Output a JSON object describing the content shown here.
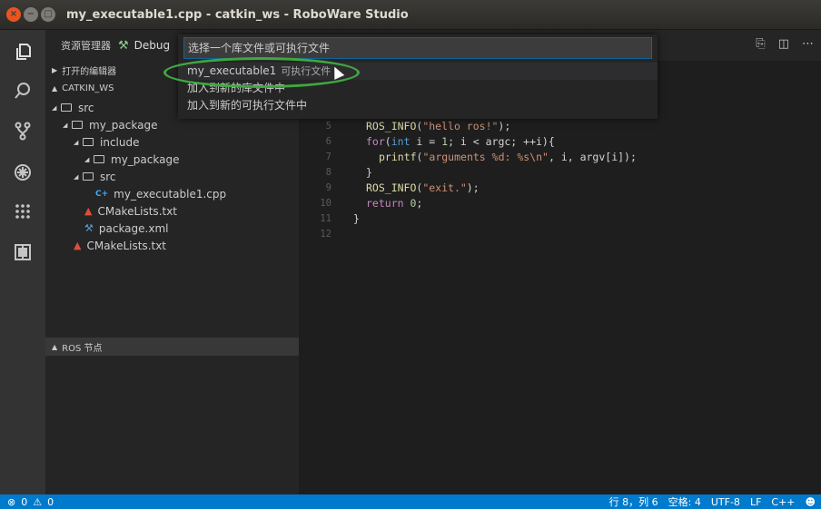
{
  "window": {
    "title": "my_executable1.cpp - catkin_ws - RoboWare Studio",
    "close_glyph": "×",
    "min_glyph": "−",
    "max_glyph": "□"
  },
  "activity_bar": {
    "items": [
      {
        "icon": "files-icon"
      },
      {
        "icon": "search-icon"
      },
      {
        "icon": "source-control-icon"
      },
      {
        "icon": "debug-icon"
      },
      {
        "icon": "extensions-icon"
      },
      {
        "icon": "ros-package-icon"
      }
    ]
  },
  "sidebar": {
    "explorer_label": "资源管理器",
    "debug_label": "Debug",
    "open_editors": "打开的编辑器",
    "workspace": "CATKIN_WS",
    "tree": [
      {
        "label": "src",
        "depth": 0,
        "kind": "folder"
      },
      {
        "label": "my_package",
        "depth": 1,
        "kind": "folder"
      },
      {
        "label": "include",
        "depth": 2,
        "kind": "folder"
      },
      {
        "label": "my_package",
        "depth": 3,
        "kind": "folder"
      },
      {
        "label": "src",
        "depth": 2,
        "kind": "folder"
      },
      {
        "label": "my_executable1.cpp",
        "depth": 3,
        "kind": "cpp"
      },
      {
        "label": "CMakeLists.txt",
        "depth": 2,
        "kind": "cmake"
      },
      {
        "label": "package.xml",
        "depth": 2,
        "kind": "xml"
      },
      {
        "label": "CMakeLists.txt",
        "depth": 1,
        "kind": "cmake"
      }
    ],
    "ros_section": "ROS 节点"
  },
  "quick_pick": {
    "placeholder": "选择一个库文件或可执行文件",
    "items": [
      {
        "label": "my_executable1",
        "description": "可执行文件"
      },
      {
        "label": "加入到新的库文件中",
        "description": ""
      },
      {
        "label": "加入到新的可执行文件中",
        "description": ""
      }
    ]
  },
  "editor": {
    "lines": [
      {
        "n": "5",
        "code": "ROS_INFO(\"hello ros!\");"
      },
      {
        "n": "6",
        "code": "for(int i = 1; i < argc; ++i){"
      },
      {
        "n": "7",
        "code": "printf(\"arguments %d: %s\\n\", i, argv[i]);"
      },
      {
        "n": "8",
        "code": "}"
      },
      {
        "n": "9",
        "code": "ROS_INFO(\"exit.\");"
      },
      {
        "n": "10",
        "code": "return 0;"
      },
      {
        "n": "11",
        "code": "}"
      },
      {
        "n": "12",
        "code": ""
      }
    ]
  },
  "status_bar": {
    "errors": "0",
    "warnings": "0",
    "position": "行 8，列 6",
    "indent": "空格: 4",
    "encoding": "UTF-8",
    "eol": "LF",
    "language": "C++",
    "accent": "#007acc"
  }
}
